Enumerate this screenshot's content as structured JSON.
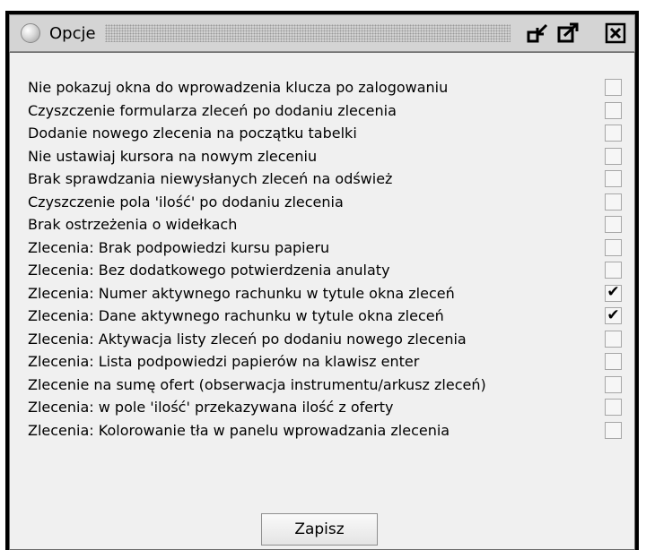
{
  "window": {
    "title": "Opcje",
    "buttons": {
      "minimize_icon": "undock-icon",
      "maximize_icon": "maximize-icon",
      "close_icon": "close-icon"
    }
  },
  "options": [
    {
      "label": "Nie pokazuj okna do wprowadzenia klucza po zalogowaniu",
      "checked": false
    },
    {
      "label": "Czyszczenie formularza zleceń po dodaniu zlecenia",
      "checked": false
    },
    {
      "label": "Dodanie nowego zlecenia na początku tabelki",
      "checked": false
    },
    {
      "label": "Nie ustawiaj kursora na nowym zleceniu",
      "checked": false
    },
    {
      "label": "Brak sprawdzania niewysłanych zleceń na odśwież",
      "checked": false
    },
    {
      "label": "Czyszczenie pola 'ilość' po dodaniu zlecenia",
      "checked": false
    },
    {
      "label": "Brak ostrzeżenia o widełkach",
      "checked": false
    },
    {
      "label": "Zlecenia: Brak podpowiedzi kursu papieru",
      "checked": false
    },
    {
      "label": "Zlecenia: Bez dodatkowego potwierdzenia anulaty",
      "checked": false
    },
    {
      "label": "Zlecenia: Numer aktywnego rachunku w tytule okna zleceń",
      "checked": true
    },
    {
      "label": "Zlecenia: Dane aktywnego rachunku w tytule okna zleceń",
      "checked": true
    },
    {
      "label": "Zlecenia: Aktywacja listy zleceń po dodaniu nowego zlecenia",
      "checked": false
    },
    {
      "label": "Zlecenia: Lista podpowiedzi papierów na klawisz enter",
      "checked": false
    },
    {
      "label": "Zlecenie na sumę ofert (obserwacja instrumentu/arkusz zleceń)",
      "checked": false
    },
    {
      "label": "Zlecenia: w pole 'ilość' przekazywana ilość z oferty",
      "checked": false
    },
    {
      "label": "Zlecenia: Kolorowanie tła w panelu wprowadzania zlecenia",
      "checked": false
    }
  ],
  "save_button": {
    "label": "Zapisz"
  }
}
